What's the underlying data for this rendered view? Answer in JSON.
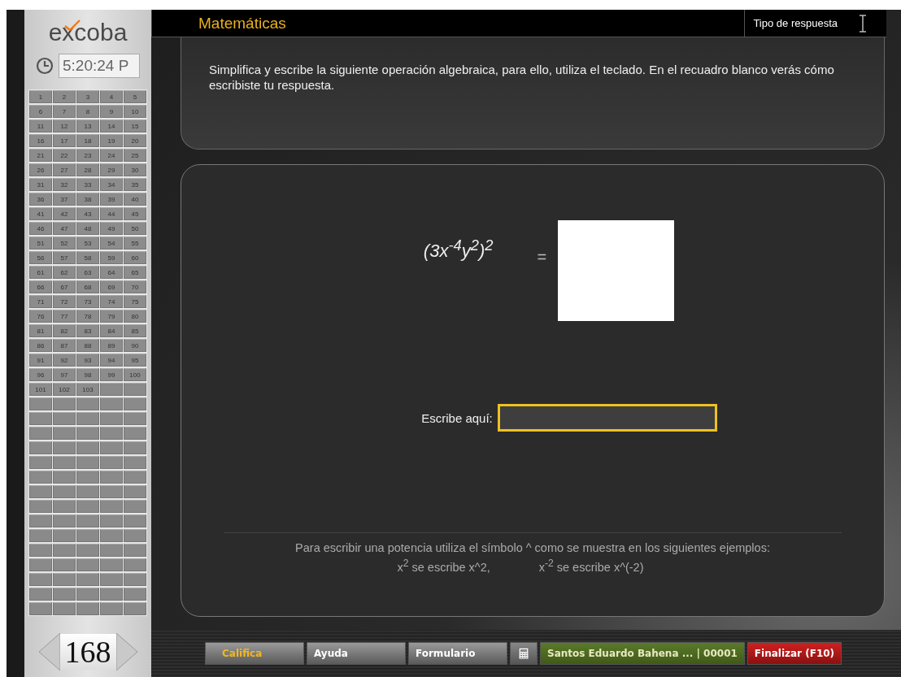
{
  "sidebar": {
    "logo": "excoba",
    "clock": "5:20:24 P",
    "questions": [
      "1",
      "2",
      "3",
      "4",
      "5",
      "6",
      "7",
      "8",
      "9",
      "10",
      "11",
      "12",
      "13",
      "14",
      "15",
      "16",
      "17",
      "18",
      "19",
      "20",
      "21",
      "22",
      "23",
      "24",
      "25",
      "26",
      "27",
      "28",
      "29",
      "30",
      "31",
      "32",
      "33",
      "34",
      "35",
      "36",
      "37",
      "38",
      "39",
      "40",
      "41",
      "42",
      "43",
      "44",
      "45",
      "46",
      "47",
      "48",
      "49",
      "50",
      "51",
      "52",
      "53",
      "54",
      "55",
      "56",
      "57",
      "58",
      "59",
      "60",
      "61",
      "62",
      "63",
      "64",
      "65",
      "66",
      "67",
      "68",
      "69",
      "70",
      "71",
      "72",
      "73",
      "74",
      "75",
      "76",
      "77",
      "78",
      "79",
      "80",
      "81",
      "82",
      "83",
      "84",
      "85",
      "86",
      "87",
      "88",
      "89",
      "90",
      "91",
      "92",
      "93",
      "94",
      "95",
      "96",
      "97",
      "98",
      "99",
      "100",
      "101",
      "102",
      "103"
    ],
    "page": "168"
  },
  "header": {
    "subject": "Matemáticas",
    "answer_type": "Tipo de respuesta"
  },
  "instructions": "Simplifica y escribe la siguiente operación algebraica, para ello, utiliza el teclado. En el recuadro blanco verás cómo escribiste tu respuesta.",
  "exercise": {
    "expression": "(3x$^{-4}$y$^{2}$)$^{2}$",
    "equals": "=",
    "input_label": "Escribe aquí:"
  },
  "hint": {
    "text": "Para escribir una potencia utiliza el símbolo ^ como se muestra en los siguientes ejemplos:",
    "examples": [
      "x$^{2}$ se escribe x^2,",
      "x$^{-2}$ se escribe x^(-2)"
    ]
  },
  "toolbar": [
    {
      "kind": "nav",
      "label": "Califica",
      "active": true
    },
    {
      "kind": "nav",
      "label": "Ayuda",
      "active": false
    },
    {
      "kind": "nav",
      "label": "Formulario",
      "active": false
    },
    {
      "kind": "calculator"
    },
    {
      "kind": "user",
      "label": "Santos Eduardo Bahena ... | 00001"
    },
    {
      "kind": "finish",
      "label": "Finalizar (F10)"
    }
  ]
}
